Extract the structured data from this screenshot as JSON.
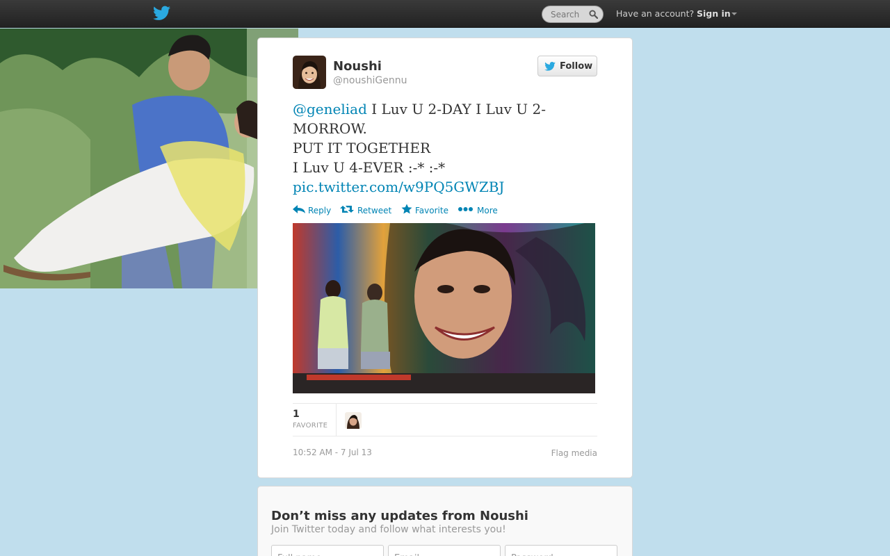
{
  "topbar": {
    "logo_icon": "twitter-bird-icon",
    "search_placeholder": "Search",
    "search_icon": "magnifier-icon",
    "have_account": "Have an account?",
    "signin_label": "Sign in",
    "caret_icon": "caret-down-icon"
  },
  "tweet": {
    "display_name": "Noushi",
    "screen_name": "@noushiGennu",
    "follow_label": "Follow",
    "text": {
      "mention": "@geneliad",
      "line1": " I Luv U 2-DAY I Luv U 2-MORROW.",
      "line2": "PUT IT TOGETHER",
      "line3": "I Luv U 4-EVER :-* :-*",
      "link": "pic.twitter.com/w9PQ5GWZBJ"
    },
    "actions": {
      "reply": "Reply",
      "retweet": "Retweet",
      "favorite": "Favorite",
      "more": "More"
    },
    "stats": {
      "favorite_count": "1",
      "favorite_label": "FAVORITE"
    },
    "timestamp": "10:52 AM - 7 Jul 13",
    "flag_media": "Flag media"
  },
  "signup": {
    "title": "Don’t miss any updates from Noushi",
    "subtitle": "Join Twitter today and follow what interests you!",
    "fullname_placeholder": "Full name",
    "email_placeholder": "Email",
    "password_placeholder": "Password"
  },
  "colors": {
    "link": "#0084b4",
    "page_background": "#c0deed",
    "topbar": "#2b2b2b"
  }
}
